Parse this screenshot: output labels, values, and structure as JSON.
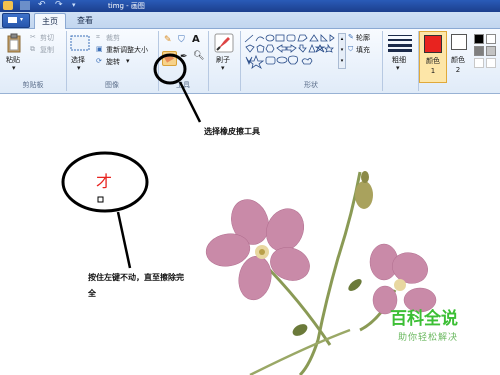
{
  "window": {
    "title": "timg - 画图"
  },
  "tabs": [
    {
      "label": "主页"
    },
    {
      "label": "查看"
    }
  ],
  "clipboard": {
    "paste_label": "粘贴",
    "cut_label": "剪切",
    "copy_label": "复制",
    "group_label": "剪贴板"
  },
  "image": {
    "select_label": "选择",
    "crop_label": "裁剪",
    "resize_label": "重新调整大小",
    "rotate_label": "旋转",
    "group_label": "图像"
  },
  "tools": {
    "group_label": "工具"
  },
  "brushes": {
    "label": "刷子"
  },
  "shapes": {
    "outline_label": "轮廓",
    "fill_label": "填充",
    "group_label": "形状"
  },
  "size": {
    "label": "粗细"
  },
  "colors": {
    "color1_label": "颜色 1",
    "color2_label": "颜色 2",
    "color1_value": "#e8231f",
    "color2_value": "#ffffff",
    "palette": [
      "#000000",
      "#ffffff",
      "#7f7f7f",
      "#c3c3c3"
    ]
  },
  "canvas": {
    "eraser_hint": "选择橡皮擦工具",
    "erase_hint": "按住左键不动，直至擦除完全",
    "red_mark": "才",
    "accent_color": "#e8231f"
  },
  "watermark": {
    "title": "百科全说",
    "subtitle": "助你轻松解决"
  }
}
